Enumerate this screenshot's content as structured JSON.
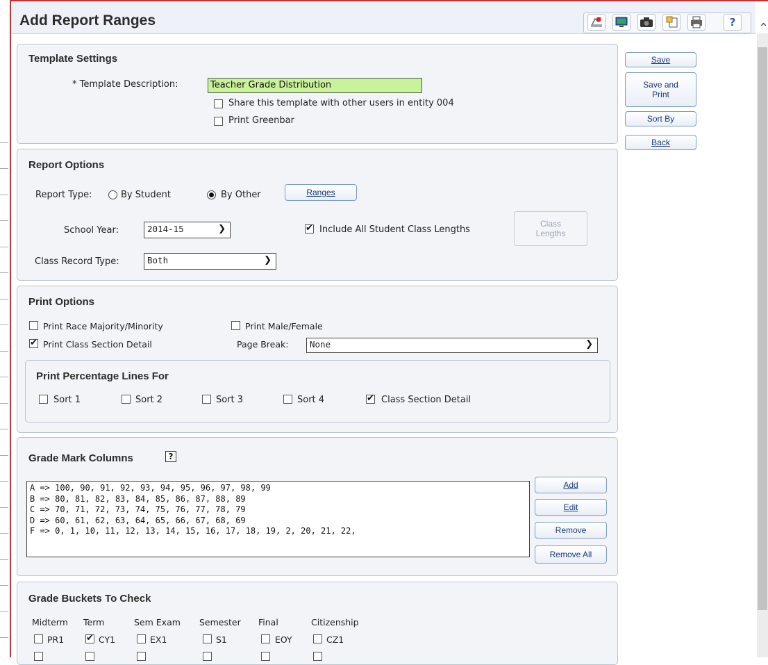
{
  "page": {
    "title": "Add Report Ranges"
  },
  "toolbar": {
    "icons": [
      "report-icon",
      "monitor-icon",
      "camera-icon",
      "copy-icon",
      "print-icon",
      "help-icon"
    ],
    "help_label": "?"
  },
  "actions": {
    "save": "Save",
    "save_print_line1": "Save and",
    "save_print_line2": "Print",
    "sort_by": "Sort By",
    "back": "Back"
  },
  "template_settings": {
    "heading": "Template Settings",
    "description_label": "* Template Description:",
    "description_value": "Teacher Grade Distribution",
    "share_label": "Share this template with other users in entity 004",
    "share_checked": false,
    "greenbar_label": "Print Greenbar",
    "greenbar_checked": false
  },
  "report_options": {
    "heading": "Report Options",
    "report_type_label": "Report Type:",
    "by_student": "By Student",
    "by_other": "By Other",
    "selected_type": "By Other",
    "ranges_button": "Ranges",
    "school_year_label": "School Year:",
    "school_year_value": "2014-15",
    "include_lengths_label": "Include All Student Class Lengths",
    "include_lengths_checked": true,
    "class_lengths_line1": "Class",
    "class_lengths_line2": "Lengths",
    "class_record_type_label": "Class Record Type:",
    "class_record_type_value": "Both"
  },
  "print_options": {
    "heading": "Print Options",
    "race_label": "Print Race Majority/Minority",
    "race_checked": false,
    "male_female_label": "Print Male/Female",
    "male_female_checked": false,
    "class_section_detail_label": "Print Class Section Detail",
    "class_section_detail_checked": true,
    "page_break_label": "Page Break:",
    "page_break_value": "None",
    "percentage": {
      "heading": "Print Percentage Lines For",
      "items": [
        {
          "label": "Sort 1",
          "checked": false
        },
        {
          "label": "Sort 2",
          "checked": false
        },
        {
          "label": "Sort 3",
          "checked": false
        },
        {
          "label": "Sort 4",
          "checked": false
        },
        {
          "label": "Class Section Detail",
          "checked": true
        }
      ]
    }
  },
  "grade_mark_columns": {
    "heading": "Grade Mark Columns",
    "help_label": "?",
    "rows": [
      "A => 100, 90, 91, 92, 93, 94, 95, 96, 97, 98, 99",
      "B => 80, 81, 82, 83, 84, 85, 86, 87, 88, 89",
      "C => 70, 71, 72, 73, 74, 75, 76, 77, 78, 79",
      "D => 60, 61, 62, 63, 64, 65, 66, 67, 68, 69",
      "F => 0, 1, 10, 11, 12, 13, 14, 15, 16, 17, 18, 19, 2, 20, 21, 22,"
    ],
    "add": "Add",
    "edit": "Edit",
    "remove": "Remove",
    "remove_all": "Remove All"
  },
  "grade_buckets": {
    "heading": "Grade Buckets To Check",
    "columns": [
      {
        "header": "Midterm",
        "item": "PR1",
        "checked": false
      },
      {
        "header": "Term",
        "item": "CY1",
        "checked": true
      },
      {
        "header": "Sem Exam",
        "item": "EX1",
        "checked": false
      },
      {
        "header": "Semester",
        "item": "S1",
        "checked": false
      },
      {
        "header": "Final",
        "item": "EOY",
        "checked": false
      },
      {
        "header": "Citizenship",
        "item": "CZ1",
        "checked": false
      }
    ]
  }
}
